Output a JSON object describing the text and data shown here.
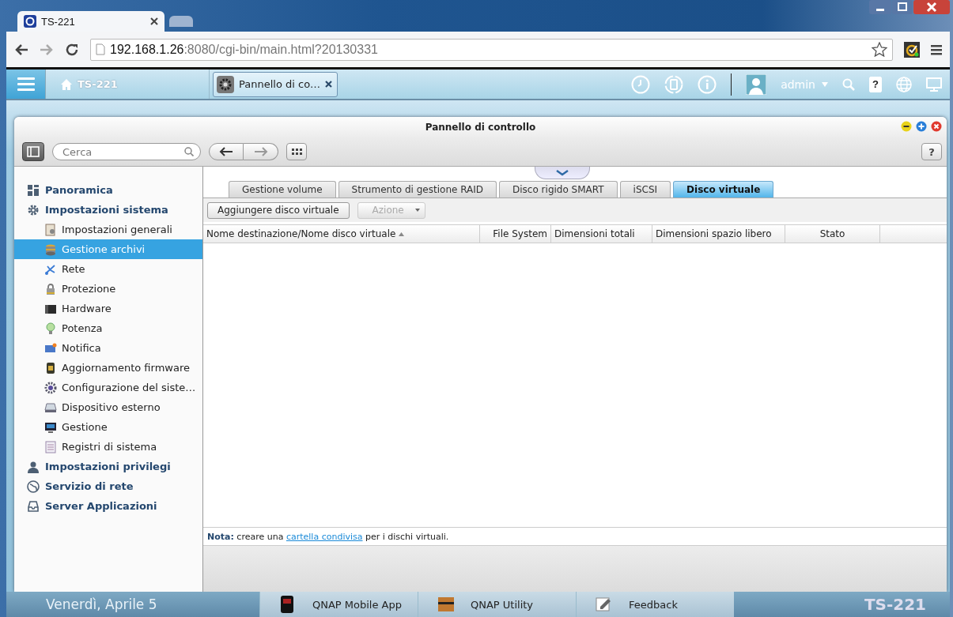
{
  "browser": {
    "tabs": [
      {
        "title": "TS-221",
        "selected": true
      },
      {
        "selected": false
      }
    ],
    "address": {
      "host": "192.168.1.26",
      "rest": ":8080/cgi-bin/main.html?20130331"
    }
  },
  "top_bar": {
    "home_label": "TS-221",
    "app_tabs": [
      {
        "label": "Pannello di co…"
      }
    ],
    "user": "admin",
    "help": "?"
  },
  "window": {
    "title": "Pannello di controllo",
    "search": {
      "placeholder": "Cerca"
    },
    "help": "?"
  },
  "sidebar": {
    "items": [
      {
        "label": "Panoramica",
        "selected": false
      },
      {
        "label": "Impostazioni sistema",
        "selected": false,
        "children": [
          {
            "label": "Impostazioni generali",
            "selected": false
          },
          {
            "label": "Gestione archivi",
            "selected": true
          },
          {
            "label": "Rete",
            "selected": false
          },
          {
            "label": "Protezione",
            "selected": false
          },
          {
            "label": "Hardware",
            "selected": false
          },
          {
            "label": "Potenza",
            "selected": false
          },
          {
            "label": "Notifica",
            "selected": false
          },
          {
            "label": "Aggiornamento firmware",
            "selected": false
          },
          {
            "label": "Configurazione del siste…",
            "selected": false
          },
          {
            "label": "Dispositivo esterno",
            "selected": false
          },
          {
            "label": "Gestione",
            "selected": false
          },
          {
            "label": "Registri di sistema",
            "selected": false
          }
        ]
      },
      {
        "label": "Impostazioni privilegi",
        "selected": false
      },
      {
        "label": "Servizio di rete",
        "selected": false
      },
      {
        "label": "Server Applicazioni",
        "selected": false
      }
    ]
  },
  "tabs": [
    {
      "label": "Gestione volume",
      "selected": false
    },
    {
      "label": "Strumento di gestione RAID",
      "selected": false
    },
    {
      "label": "Disco rigido SMART",
      "selected": false
    },
    {
      "label": "iSCSI",
      "selected": false
    },
    {
      "label": "Disco virtuale",
      "selected": true
    }
  ],
  "toolbar": [
    {
      "label": "Aggiungere disco virtuale",
      "kind": "button",
      "disabled": false
    },
    {
      "label": "Azione",
      "kind": "dropdown",
      "disabled": true
    }
  ],
  "table": {
    "columns": [
      {
        "label": "Nome destinazione/Nome disco virtuale",
        "sorted": true
      },
      {
        "label": "File System",
        "sorted": false
      },
      {
        "label": "Dimensioni totali",
        "sorted": false
      },
      {
        "label": "Dimensioni spazio libero",
        "sorted": false
      },
      {
        "label": "Stato",
        "sorted": false
      }
    ]
  },
  "note": {
    "text": "**Nota:** creare una ",
    "link": "cartella condivisa",
    "after": " per i dischi virtuali."
  },
  "desktop": {
    "date": "Venerdì, Aprile 5",
    "dock": [
      {
        "label": "QNAP Mobile App"
      },
      {
        "label": "QNAP Utility"
      },
      {
        "label": "Feedback"
      }
    ],
    "brand": "TS-221"
  }
}
